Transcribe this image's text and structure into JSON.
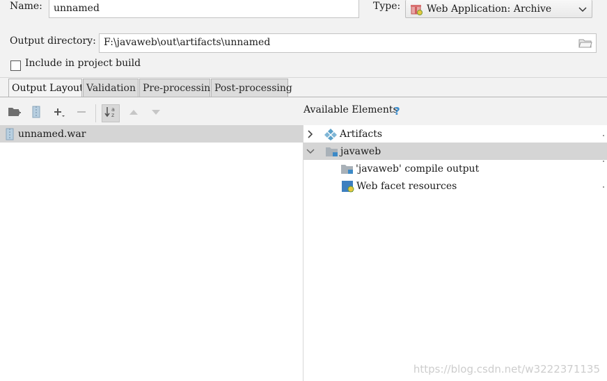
{
  "form": {
    "name_label": "Name:",
    "name_value": "unnamed",
    "type_label": "Type:",
    "type_value": "Web Application: Archive",
    "output_dir_label": "Output directory:",
    "output_dir_value": "F:\\javaweb\\out\\artifacts\\unnamed",
    "include_build_label": "Include in project build",
    "include_build_checked": false
  },
  "tabs": [
    {
      "label": "Output Layout",
      "active": true
    },
    {
      "label": "Validation",
      "active": false
    },
    {
      "label": "Pre-processing",
      "active": false
    },
    {
      "label": "Post-processing",
      "active": false
    }
  ],
  "layout_tree": {
    "items": [
      {
        "label": "unnamed.war",
        "icon": "war-archive-icon",
        "selected": true
      }
    ]
  },
  "available": {
    "header": "Available Elements",
    "help_glyph": "?",
    "items": [
      {
        "label": "Artifacts",
        "icon": "artifacts-icon",
        "expander": "collapsed"
      },
      {
        "label": "javaweb",
        "icon": "module-folder-icon",
        "expander": "expanded",
        "selected": true
      },
      {
        "label": "'javaweb' compile output",
        "icon": "compile-output-folder-icon"
      },
      {
        "label": "Web facet resources",
        "icon": "web-facet-icon"
      }
    ]
  },
  "watermark": "https://blog.csdn.net/w3222371135",
  "colors": {
    "selection": "#d5d5d5",
    "help": "#3c8fd0",
    "artifacts_icon": "#5aa0c8"
  }
}
